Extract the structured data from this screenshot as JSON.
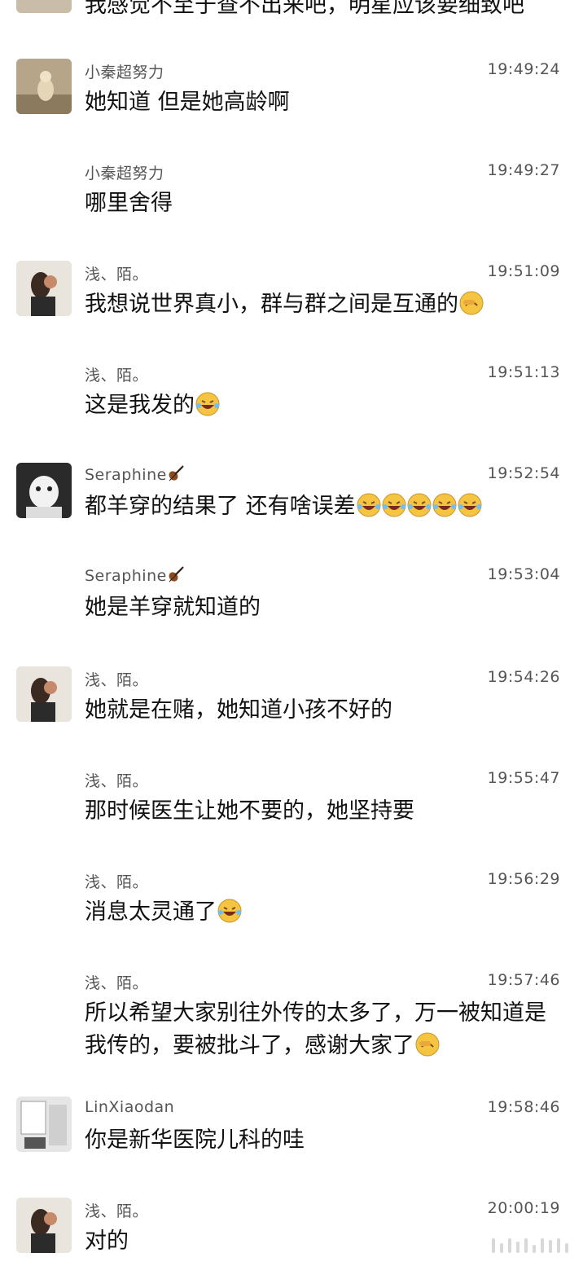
{
  "top_message": {
    "text": "我感觉不至于查不出来吧，明星应该要细致吧"
  },
  "messages": [
    {
      "sender": "小秦超努力",
      "time": "19:49:24",
      "text": "她知道 但是她高龄啊",
      "avatar": "cat-photo"
    },
    {
      "sender": "小秦超努力",
      "time": "19:49:27",
      "text": "哪里舍得",
      "avatar": ""
    },
    {
      "sender": "浅、陌。",
      "time": "19:51:09",
      "text": "我想说世界真小，群与群之间是互通的",
      "avatar": "girl-photo"
    },
    {
      "sender": "浅、陌。",
      "time": "19:51:13",
      "text": "这是我发的",
      "avatar": ""
    },
    {
      "sender": "Seraphine",
      "time": "19:52:54",
      "text": "都羊穿的结果了 还有啥误差",
      "avatar": "dog-photo"
    },
    {
      "sender": "Seraphine",
      "time": "19:53:04",
      "text": "她是羊穿就知道的",
      "avatar": ""
    },
    {
      "sender": "浅、陌。",
      "time": "19:54:26",
      "text": "她就是在赌，她知道小孩不好的",
      "avatar": "girl-photo"
    },
    {
      "sender": "浅、陌。",
      "time": "19:55:47",
      "text": "那时候医生让她不要的，她坚持要",
      "avatar": ""
    },
    {
      "sender": "浅、陌。",
      "time": "19:56:29",
      "text": "消息太灵通了",
      "avatar": ""
    },
    {
      "sender": "浅、陌。",
      "time": "19:57:46",
      "text": "所以希望大家别往外传的太多了，万一被知道是我传的，要被批斗了，感谢大家了",
      "avatar": ""
    },
    {
      "sender": "LinXiaodan",
      "time": "19:58:46",
      "text": "你是新华医院儿科的哇",
      "avatar": "room-photo"
    },
    {
      "sender": "浅、陌。",
      "time": "20:00:19",
      "text": "对的",
      "avatar": "girl-photo"
    }
  ],
  "colors": {
    "background": "#ffffff",
    "name": "#555555",
    "text": "#111111",
    "emoji_face": "#f5c542"
  }
}
